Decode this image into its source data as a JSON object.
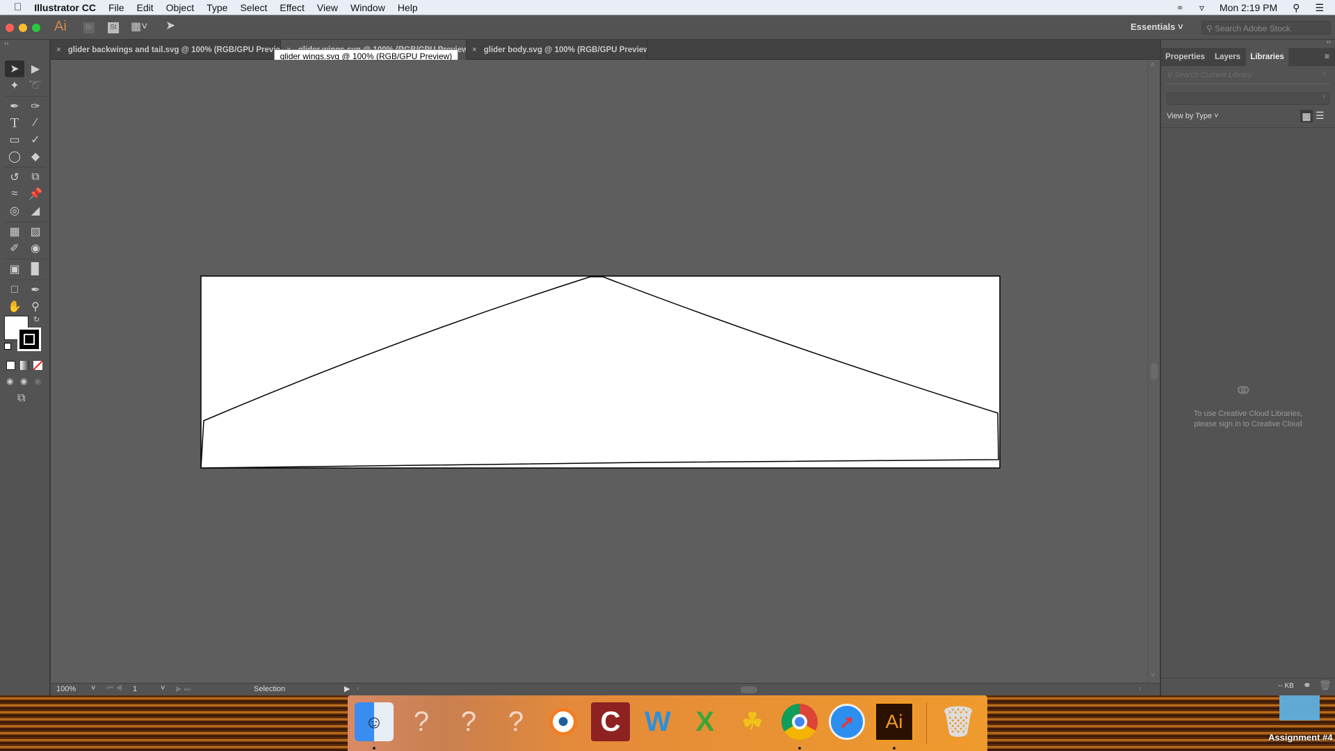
{
  "menubar": {
    "app_name": "Illustrator CC",
    "items": [
      "File",
      "Edit",
      "Object",
      "Type",
      "Select",
      "Effect",
      "View",
      "Window",
      "Help"
    ],
    "clock": "Mon 2:19 PM"
  },
  "control": {
    "ai_logo": "Ai",
    "bridge": "Br",
    "stock": "St",
    "workspace": "Essentials",
    "search_placeholder": "Search Adobe Stock"
  },
  "tabs": [
    {
      "label": "glider backwings and tail.svg @ 100% (RGB/GPU Preview)",
      "active": false
    },
    {
      "label": "glider wings.svg @ 100% (RGB/GPU Preview)",
      "active": true
    },
    {
      "label": "glider body.svg @ 100% (RGB/GPU Preview)",
      "active": false
    }
  ],
  "tab_close": "×",
  "tooltip": "glider wings.svg @ 100% (RGB/GPU Preview)",
  "tools": [
    "selection",
    "direct-selection",
    "magic-wand",
    "lasso",
    "pen",
    "curvature",
    "type",
    "line-segment",
    "rectangle",
    "paintbrush",
    "shaper",
    "eraser",
    "rotate",
    "scale",
    "width",
    "puppet-warp",
    "shape-builder",
    "perspective-grid",
    "mesh",
    "gradient",
    "eyedropper",
    "blend",
    "symbol-sprayer",
    "column-graph",
    "artboard",
    "slice",
    "hand",
    "zoom"
  ],
  "colors": {
    "fill": "#ffffff",
    "stroke": "#000000",
    "accent_none": "#ff0000"
  },
  "status": {
    "zoom": "100%",
    "artboard": "1",
    "tool": "Selection"
  },
  "panel": {
    "tabs": [
      "Properties",
      "Layers",
      "Libraries"
    ],
    "active_tab": "Libraries",
    "search_placeholder": "Search Current Library",
    "view_by": "View by Type",
    "message_line1": "To use Creative Cloud Libraries,",
    "message_line2": "please sign in to Creative Cloud",
    "kb": "-- KB"
  },
  "dock": [
    "Finder",
    "?",
    "?",
    "?",
    "Blender",
    "Cinema",
    "Word",
    "Excel",
    "Fetch",
    "Chrome",
    "Safari",
    "Ai",
    "Trash"
  ],
  "desktop": {
    "folder_label": "Assignment #4"
  }
}
